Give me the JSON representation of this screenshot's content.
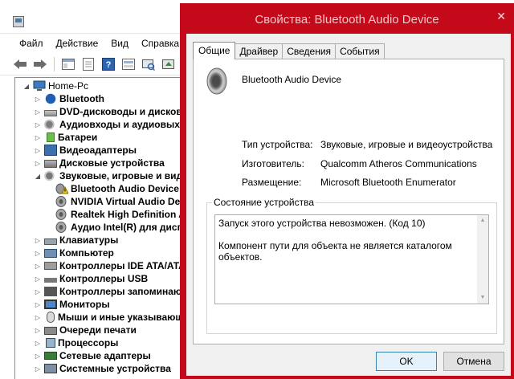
{
  "device_manager": {
    "menu": [
      "Файл",
      "Действие",
      "Вид",
      "Справка"
    ],
    "tree": {
      "root": "Home-Pc",
      "items": [
        {
          "label": "Bluetooth",
          "icon": "bluetooth-icon"
        },
        {
          "label": "DVD-дисководы и дисково",
          "icon": "dvd-drive-icon"
        },
        {
          "label": "Аудиовходы и аудиовыход",
          "icon": "audio-io-icon"
        },
        {
          "label": "Батареи",
          "icon": "battery-icon"
        },
        {
          "label": "Видеоадаптеры",
          "icon": "display-adapter-icon"
        },
        {
          "label": "Дисковые устройства",
          "icon": "disk-drive-icon"
        },
        {
          "label": "Звуковые, игровые и видео",
          "icon": "sound-icon",
          "expanded": true,
          "children": [
            {
              "label": "Bluetooth Audio Device",
              "icon": "warning-speaker-icon"
            },
            {
              "label": "NVIDIA Virtual Audio De",
              "icon": "speaker-icon"
            },
            {
              "label": "Realtek High Definition A",
              "icon": "speaker-icon"
            },
            {
              "label": "Аудио Intel(R) для дисп",
              "icon": "speaker-icon"
            }
          ]
        },
        {
          "label": "Клавиатуры",
          "icon": "keyboard-icon"
        },
        {
          "label": "Компьютер",
          "icon": "computer-icon"
        },
        {
          "label": "Контроллеры IDE ATA/ATAP",
          "icon": "ide-controller-icon"
        },
        {
          "label": "Контроллеры USB",
          "icon": "usb-icon"
        },
        {
          "label": "Контроллеры запоминаю",
          "icon": "storage-controller-icon"
        },
        {
          "label": "Мониторы",
          "icon": "monitor-icon"
        },
        {
          "label": "Мыши и иные указывающ",
          "icon": "mouse-icon"
        },
        {
          "label": "Очереди печати",
          "icon": "printer-icon"
        },
        {
          "label": "Процессоры",
          "icon": "processor-icon"
        },
        {
          "label": "Сетевые адаптеры",
          "icon": "network-adapter-icon"
        },
        {
          "label": "Системные устройства",
          "icon": "system-device-icon"
        }
      ]
    }
  },
  "dialog": {
    "title": "Свойства: Bluetooth Audio Device",
    "tabs": [
      "Общие",
      "Драйвер",
      "Сведения",
      "События"
    ],
    "active_tab": "Общие",
    "device_name": "Bluetooth Audio Device",
    "properties": [
      {
        "label": "Тип устройства:",
        "value": "Звуковые, игровые и видеоустройства"
      },
      {
        "label": "Изготовитель:",
        "value": "Qualcomm Atheros Communications"
      },
      {
        "label": "Размещение:",
        "value": "Microsoft Bluetooth Enumerator"
      }
    ],
    "status_group_label": "Состояние устройства",
    "status_text": "Запуск этого устройства невозможен. (Код 10)\n\nКомпонент пути для объекта не является каталогом\nобъектов.",
    "ok_label": "OK",
    "cancel_label": "Отмена"
  },
  "colors": {
    "dialog_frame": "#c4091a",
    "dialog_title_text": "#f3c6c9",
    "ok_button_border": "#3c7fb1"
  }
}
